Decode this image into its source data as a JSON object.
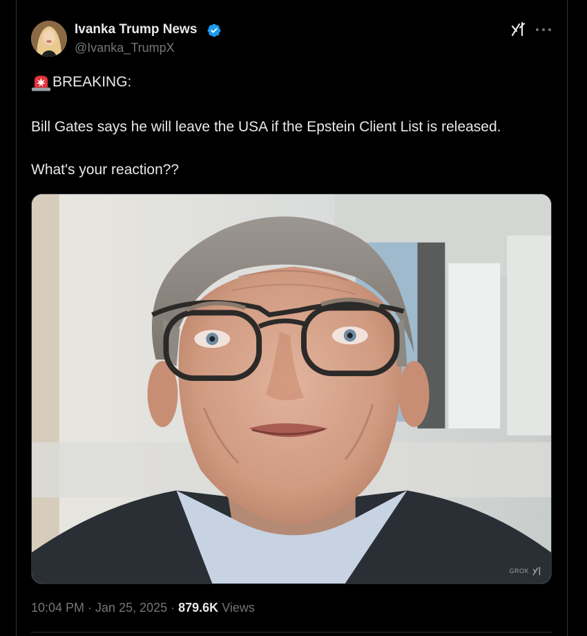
{
  "author": {
    "display_name": "Ivanka Trump News",
    "handle": "@Ivanka_TrumpX",
    "verified": true
  },
  "icons": {
    "grok": "grok-icon",
    "more": "more-icon",
    "verified": "verified-badge-icon",
    "siren": "police-light-emoji-icon"
  },
  "tweet": {
    "breaking": "BREAKING:",
    "line1": "Bill Gates says he will leave the USA if the Epstein Client List is released.",
    "line2": "What's your reaction??"
  },
  "media": {
    "watermark": "GROK"
  },
  "meta": {
    "time": "10:04 PM",
    "sep1": " · ",
    "date": "Jan 25, 2025",
    "sep2": " · ",
    "views_count": "879.6K",
    "views_label": " Views"
  },
  "colors": {
    "background": "#000000",
    "text": "#e7e9ea",
    "secondary": "#71767b",
    "verified_blue": "#1d9bf0",
    "border": "#2f3336"
  }
}
